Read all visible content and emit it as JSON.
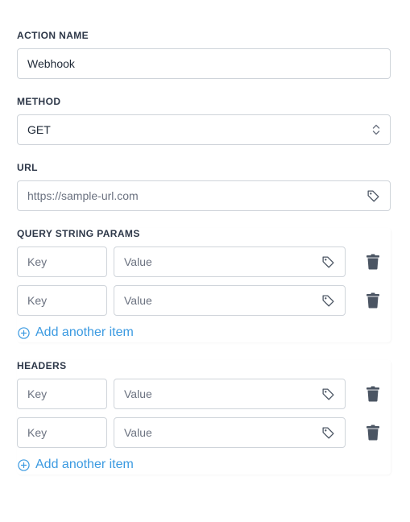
{
  "action_name": {
    "label": "ACTION NAME",
    "value": "Webhook"
  },
  "method": {
    "label": "METHOD",
    "value": "GET"
  },
  "url": {
    "label": "URL",
    "placeholder": "https://sample-url.com"
  },
  "query_params": {
    "label": "QUERY STRING PARAMS",
    "rows": [
      {
        "key_placeholder": "Key",
        "value_placeholder": "Value"
      },
      {
        "key_placeholder": "Key",
        "value_placeholder": "Value"
      }
    ],
    "add_label": "Add another item"
  },
  "headers": {
    "label": "HEADERS",
    "rows": [
      {
        "key_placeholder": "Key",
        "value_placeholder": "Value"
      },
      {
        "key_placeholder": "Key",
        "value_placeholder": "Value"
      }
    ],
    "add_label": "Add another item"
  },
  "colors": {
    "accent": "#3b9ae1",
    "trash": "#4b5563",
    "border": "#cfd4da"
  }
}
